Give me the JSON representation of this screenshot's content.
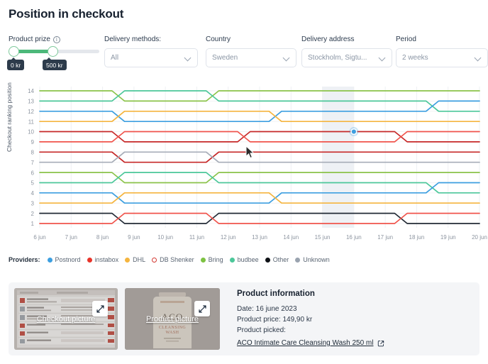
{
  "page": {
    "title": "Position in checkout"
  },
  "filters": {
    "slider": {
      "label": "Product prize",
      "info_icon": "info-icon",
      "min_label": "0 kr",
      "max_label": "500 kr",
      "fill_color": "#4cb87a"
    },
    "selects": [
      {
        "label": "Delivery methods:",
        "value": "All"
      },
      {
        "label": "Country",
        "value": "Sweden"
      },
      {
        "label": "Delivery address",
        "value": "Stockholm, Sigtu..."
      },
      {
        "label": "Period",
        "value": "2 weeks"
      }
    ]
  },
  "legend": {
    "title": "Providers:",
    "items": [
      {
        "label": "Postnord",
        "color": "#3d9fe0",
        "style": "dot"
      },
      {
        "label": "instabox",
        "color": "#e8342a",
        "style": "dot"
      },
      {
        "label": "DHL",
        "color": "#f5b53f",
        "style": "dot"
      },
      {
        "label": "DB Shenker",
        "color": "#d33a33",
        "style": "ring"
      },
      {
        "label": "Bring",
        "color": "#7dc242",
        "style": "dot"
      },
      {
        "label": "budbee",
        "color": "#4cc79a",
        "style": "dot"
      },
      {
        "label": "Other",
        "color": "#0e1116",
        "style": "dot"
      },
      {
        "label": "Unknown",
        "color": "#9aa3af",
        "style": "dot"
      }
    ]
  },
  "chart_data": {
    "type": "line",
    "title": "",
    "xlabel": "",
    "ylabel": "Checkout ranking position",
    "x": [
      "6 jun",
      "7 jun",
      "8 jun",
      "9 jun",
      "10 jun",
      "11 jun",
      "12 jun",
      "13 jun",
      "14 jun",
      "15 jun",
      "16 jun",
      "17 jun",
      "18 jun",
      "19 jun",
      "20 jun"
    ],
    "ylim": [
      1,
      14
    ],
    "yticks": [
      1,
      2,
      3,
      4,
      5,
      6,
      7,
      8,
      9,
      10,
      11,
      12,
      13,
      14
    ],
    "grid": true,
    "legend_position": "bottom",
    "highlight": {
      "x": "16 jun",
      "y": 10,
      "series": "Postnord",
      "color": "#3d9fe0"
    },
    "highlight_band": {
      "from": "15 jun",
      "to": "16 jun"
    },
    "series": [
      {
        "name": "Bring A",
        "color": "#8bc34a",
        "values": [
          14,
          14,
          14,
          13,
          13,
          13,
          14,
          14,
          14,
          14,
          14,
          14,
          14,
          14,
          14
        ]
      },
      {
        "name": "budbee A",
        "color": "#4cc79a",
        "values": [
          13,
          13,
          13,
          14,
          14,
          14,
          13,
          13,
          13,
          13,
          13,
          13,
          13,
          12,
          12
        ]
      },
      {
        "name": "Postnord A",
        "color": "#3d9fe0",
        "values": [
          12,
          12,
          12,
          11,
          11,
          11,
          11,
          11,
          12,
          12,
          12,
          12,
          12,
          13,
          13
        ]
      },
      {
        "name": "DHL A",
        "color": "#f5b53f",
        "values": [
          11,
          11,
          11,
          12,
          12,
          12,
          12,
          12,
          11,
          11,
          11,
          11,
          11,
          11,
          11
        ]
      },
      {
        "name": "DB Shenker A",
        "color": "#c62828",
        "values": [
          10,
          10,
          10,
          9,
          9,
          9,
          9,
          10,
          10,
          10,
          10,
          10,
          9,
          9,
          9
        ]
      },
      {
        "name": "instabox A",
        "color": "#f0544c",
        "values": [
          9,
          9,
          9,
          10,
          10,
          10,
          10,
          9,
          9,
          9,
          9,
          9,
          10,
          10,
          10
        ]
      },
      {
        "name": "DB Shenker B",
        "color": "#c62828",
        "values": [
          8,
          8,
          8,
          7,
          7,
          7,
          8,
          8,
          8,
          8,
          8,
          8,
          8,
          8,
          8
        ]
      },
      {
        "name": "Unknown",
        "color": "#a7adb8",
        "values": [
          7,
          7,
          7,
          8,
          8,
          8,
          7,
          7,
          7,
          7,
          7,
          7,
          7,
          7,
          7
        ]
      },
      {
        "name": "Bring B",
        "color": "#8bc34a",
        "values": [
          6,
          6,
          6,
          5,
          5,
          5,
          6,
          6,
          6,
          6,
          6,
          6,
          6,
          6,
          6
        ]
      },
      {
        "name": "budbee B",
        "color": "#4cc79a",
        "values": [
          5,
          5,
          5,
          6,
          6,
          6,
          5,
          5,
          5,
          5,
          5,
          5,
          5,
          4,
          4
        ]
      },
      {
        "name": "Postnord B",
        "color": "#3d9fe0",
        "values": [
          4,
          4,
          4,
          3,
          3,
          3,
          3,
          3,
          4,
          4,
          4,
          4,
          4,
          5,
          5
        ]
      },
      {
        "name": "DHL B",
        "color": "#f5b53f",
        "values": [
          3,
          3,
          3,
          4,
          4,
          4,
          4,
          4,
          3,
          3,
          3,
          3,
          3,
          3,
          3
        ]
      },
      {
        "name": "Other",
        "color": "#232b36",
        "values": [
          2,
          2,
          2,
          1,
          1,
          1,
          2,
          2,
          2,
          2,
          2,
          2,
          1,
          1,
          1
        ]
      },
      {
        "name": "instabox B",
        "color": "#f0544c",
        "values": [
          1,
          1,
          1,
          2,
          2,
          2,
          1,
          1,
          1,
          1,
          1,
          1,
          2,
          2,
          2
        ]
      }
    ]
  },
  "info_card": {
    "thumbnails": [
      {
        "label": "Checkout picture",
        "expand_icon": "expand-icon"
      },
      {
        "label": "Product picture",
        "expand_icon": "expand-icon"
      }
    ],
    "heading": "Product information",
    "date_line": "Date: 16 june 2023",
    "price_line": "Product price: 149,90 kr",
    "picked_line": "Product picked:",
    "product_link": "ACO Intimate Care Cleansing Wash 250 ml",
    "external_icon": "external-link-icon"
  }
}
